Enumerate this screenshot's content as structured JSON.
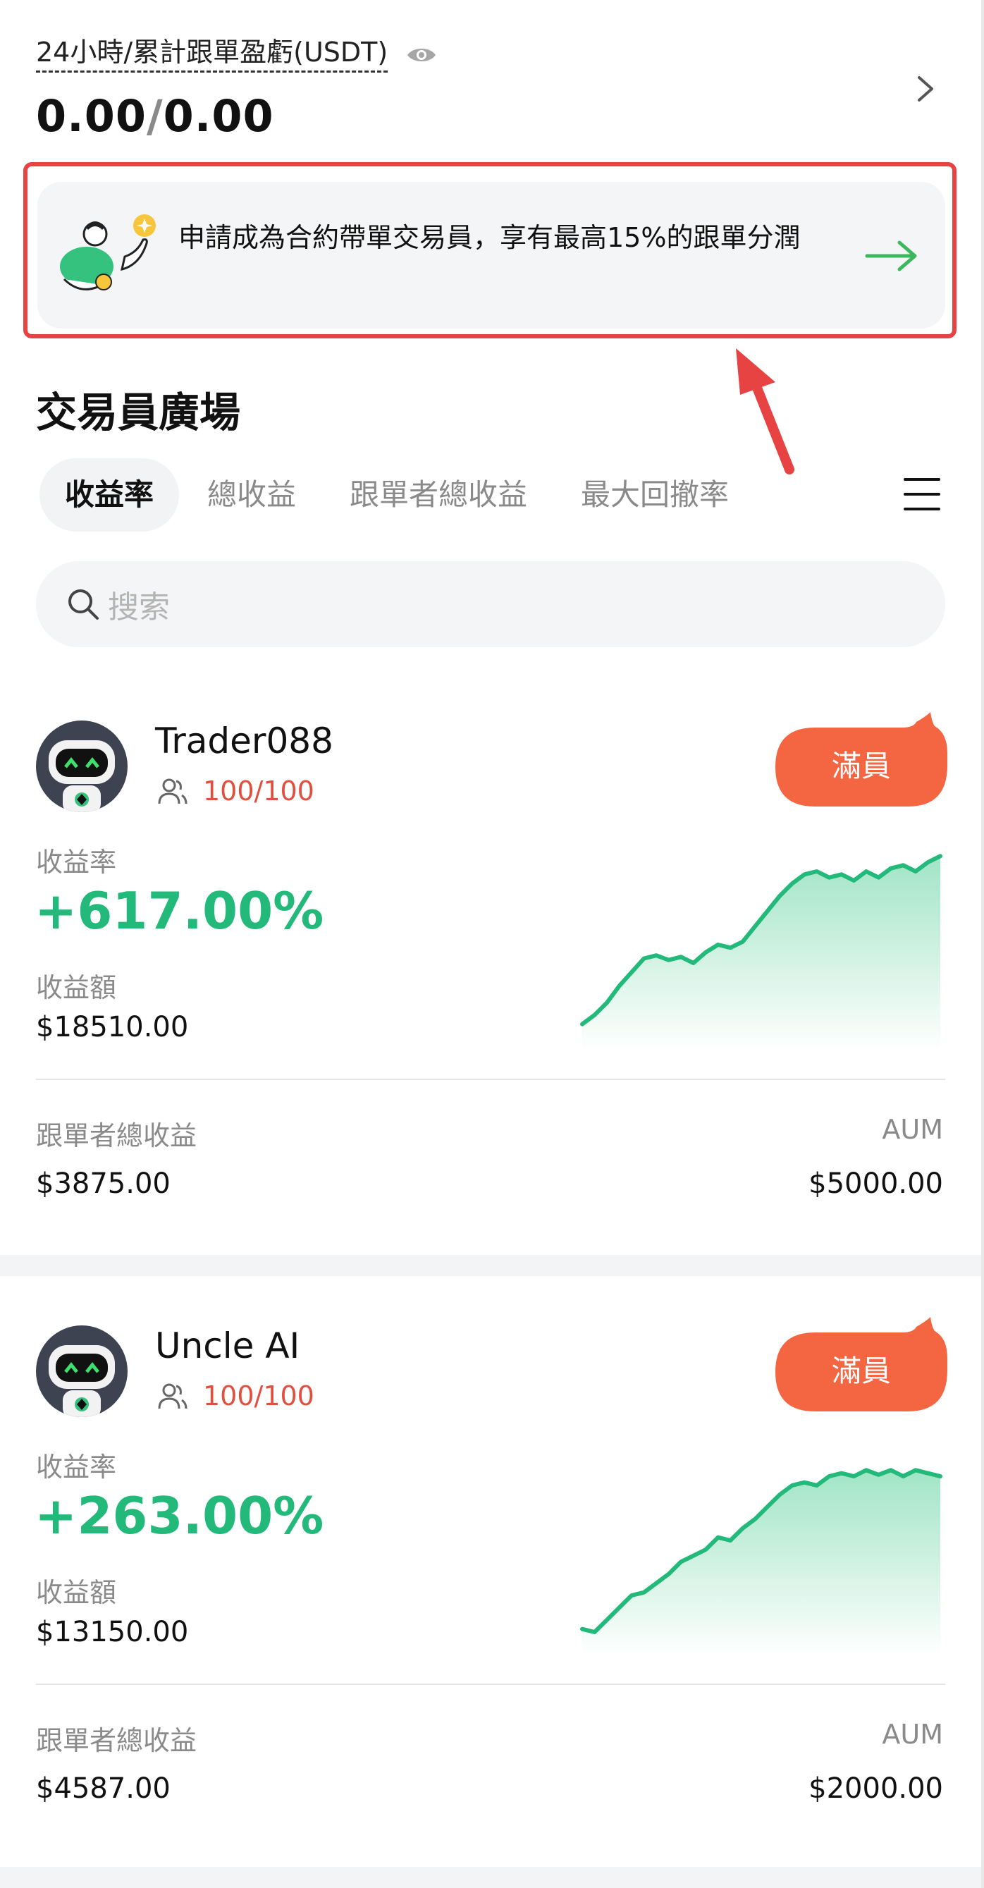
{
  "header": {
    "pnl_label": "24小時/累計跟單盈虧(USDT)",
    "pnl_24h": "0.00",
    "pnl_sep": "/",
    "pnl_total": "0.00"
  },
  "banner": {
    "text": "申請成為合約帶單交易員，享有最高15%的跟單分潤"
  },
  "section": {
    "title": "交易員廣場"
  },
  "tabs": [
    {
      "label": "收益率",
      "active": true
    },
    {
      "label": "總收益",
      "active": false
    },
    {
      "label": "跟單者總收益",
      "active": false
    },
    {
      "label": "最大回撤率",
      "active": false
    }
  ],
  "search": {
    "placeholder": "搜索"
  },
  "traders": [
    {
      "name": "Trader088",
      "followers": "100/100",
      "badge": "滿員",
      "ror_label": "收益率",
      "ror": "+617.00%",
      "pnl_label": "收益額",
      "pnl": "$18510.00",
      "follower_gain_label": "跟單者總收益",
      "follower_gain": "$3875.00",
      "aum_label": "AUM",
      "aum": "$5000.00",
      "spark": [
        8,
        14,
        22,
        33,
        42,
        51,
        53,
        50,
        52,
        48,
        55,
        60,
        58,
        62,
        72,
        82,
        92,
        100,
        106,
        108,
        104,
        106,
        102,
        108,
        104,
        110,
        112,
        108,
        114,
        118
      ]
    },
    {
      "name": "Uncle AI",
      "followers": "100/100",
      "badge": "滿員",
      "ror_label": "收益率",
      "ror": "+263.00%",
      "pnl_label": "收益額",
      "pnl": "$13150.00",
      "follower_gain_label": "跟單者總收益",
      "follower_gain": "$4587.00",
      "aum_label": "AUM",
      "aum": "$2000.00",
      "spark": [
        8,
        6,
        14,
        22,
        30,
        32,
        38,
        44,
        52,
        56,
        60,
        68,
        66,
        74,
        80,
        88,
        96,
        102,
        104,
        102,
        108,
        110,
        108,
        112,
        109,
        112,
        108,
        112,
        110,
        108
      ]
    }
  ],
  "colors": {
    "accent_green": "#22b97a",
    "badge_orange": "#f46542",
    "highlight_red": "#e74343",
    "follower_red": "#e1503e"
  }
}
